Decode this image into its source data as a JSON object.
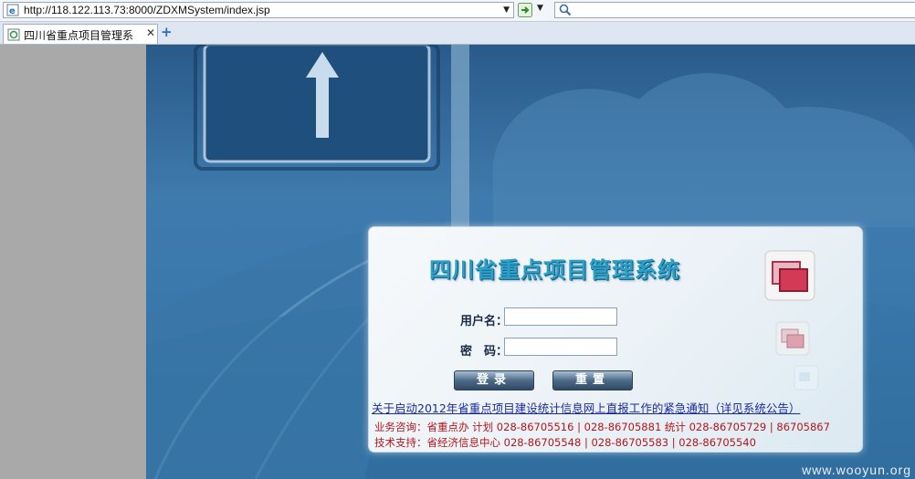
{
  "browser": {
    "url": "http://118.122.113.73:8000/ZDXMSystem/index.jsp",
    "tab_title": "四川省重点项目管理系",
    "tab_close": "✕",
    "new_tab": "+"
  },
  "login": {
    "title": "四川省重点项目管理系统",
    "username_label": "用户名：",
    "password_label": "密　码：",
    "username_value": "",
    "password_value": "",
    "login_button": "登录",
    "reset_button": "重置",
    "notice_link": "关于启动2012年省重点项目建设统计信息网上直报工作的紧急通知（详见系统公告）",
    "contact_business": "业务咨询：省重点办  计划  028-86705516 | 028-86705881 统计  028-86705729 | 86705867",
    "contact_tech": "技术支持：省经济信息中心  028-86705548 | 028-86705583 | 028-86705540"
  },
  "watermark": "www.wooyun.org",
  "colors": {
    "title_color": "#2da0c8",
    "notice_color": "#1b2b9a",
    "contact_color": "#b3161c"
  }
}
